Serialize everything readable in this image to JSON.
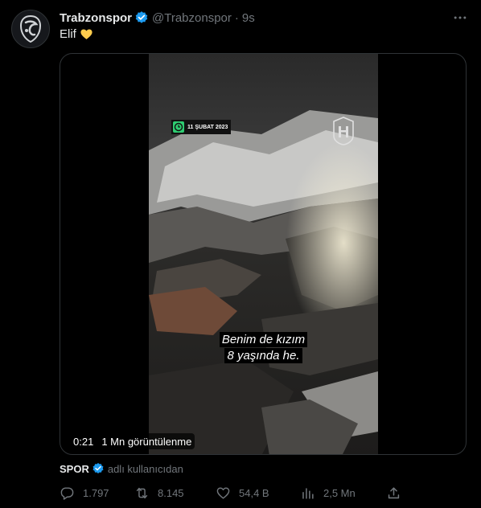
{
  "tweet": {
    "display_name": "Trabzonspor",
    "handle": "@Trabzonspor",
    "separator": "·",
    "time": "9s",
    "text": "Elif",
    "more_icon": "more-dots-icon"
  },
  "media": {
    "date_badge": "11 ŞUBAT 2023",
    "subtitle_line1": "Benim de kızım",
    "subtitle_line2": "8 yaşında he.",
    "duration": "0:21",
    "views": "1 Mn görüntülenme"
  },
  "attribution": {
    "source": "SPOR",
    "suffix": "adlı kullanıcıdan"
  },
  "actions": {
    "replies": "1.797",
    "retweets": "8.145",
    "likes": "54,4 B",
    "views": "2,5 Mn"
  },
  "colors": {
    "background": "#000000",
    "text": "#e7e9ea",
    "muted": "#71767b",
    "verified": "#1d9bf0",
    "border": "#2f3336",
    "heart_emoji": "#ffcc4d"
  }
}
